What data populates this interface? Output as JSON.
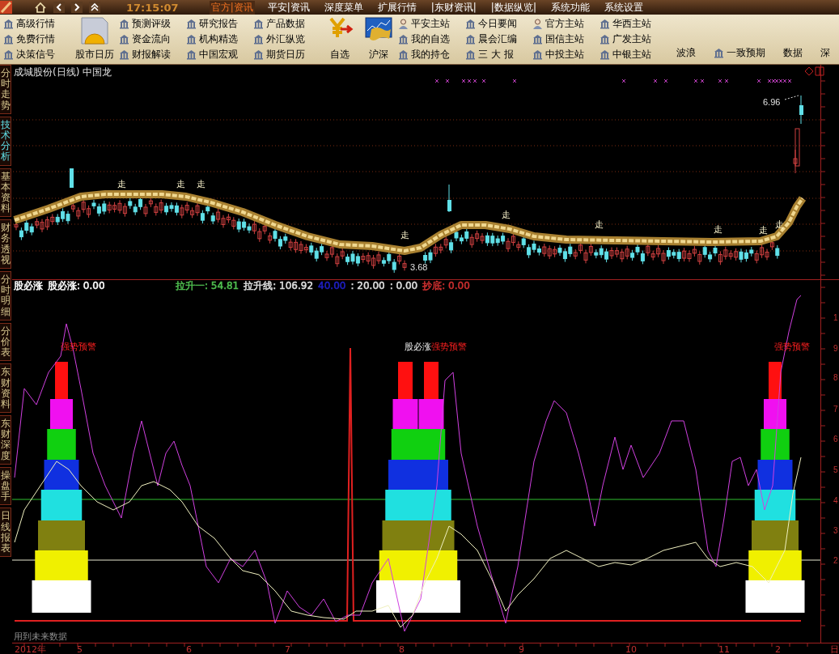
{
  "top_bar": {
    "time": "17:15:07",
    "menus": [
      {
        "label": "官方|资讯",
        "selected": true
      },
      {
        "label": "平安|资讯",
        "selected": false
      },
      {
        "label": "深度菜单",
        "selected": false
      },
      {
        "label": "扩展行情",
        "selected": false
      },
      {
        "label": "|东财资讯|",
        "selected": false
      },
      {
        "label": "|数据纵览|",
        "selected": false
      },
      {
        "label": "系统功能",
        "selected": false
      },
      {
        "label": "系统设置",
        "selected": false
      }
    ]
  },
  "toolbar": {
    "columns": [
      {
        "kind": "list",
        "items": [
          {
            "label": "高级行情",
            "kind": "bank"
          },
          {
            "label": "免费行情",
            "kind": "bank"
          },
          {
            "label": "决策信号",
            "kind": "bank"
          }
        ]
      },
      {
        "kind": "big",
        "label": "股市日历"
      },
      {
        "kind": "list",
        "items": [
          {
            "label": "预测评级",
            "kind": "bank"
          },
          {
            "label": "资金流向",
            "kind": "bank"
          },
          {
            "label": "财报解读",
            "kind": "bank"
          }
        ]
      },
      {
        "kind": "list",
        "items": [
          {
            "label": "研究报告",
            "kind": "bank"
          },
          {
            "label": "机构精选",
            "kind": "bank"
          },
          {
            "label": "中国宏观",
            "kind": "bank"
          }
        ]
      },
      {
        "kind": "list",
        "items": [
          {
            "label": "产品数据",
            "kind": "bank"
          },
          {
            "label": "外汇纵览",
            "kind": "bank"
          },
          {
            "label": "期货日历",
            "kind": "bank"
          }
        ]
      },
      {
        "kind": "big",
        "label": "自选"
      },
      {
        "kind": "big",
        "label": "沪深"
      },
      {
        "kind": "list",
        "items": [
          {
            "label": "平安主站",
            "kind": "person"
          },
          {
            "label": "我的自选",
            "kind": "bank"
          },
          {
            "label": "我的持仓",
            "kind": "bank"
          }
        ]
      },
      {
        "kind": "list",
        "items": [
          {
            "label": "今日要闻",
            "kind": "bank"
          },
          {
            "label": "晨会汇编",
            "kind": "bank"
          },
          {
            "label": "三 大 报",
            "kind": "bank"
          }
        ]
      },
      {
        "kind": "list",
        "items": [
          {
            "label": "官方主站",
            "kind": "person"
          },
          {
            "label": "国信主站",
            "kind": "bank"
          },
          {
            "label": "中投主站",
            "kind": "bank"
          }
        ]
      },
      {
        "kind": "list",
        "items": [
          {
            "label": "华西主站",
            "kind": "bank"
          },
          {
            "label": "广发主站",
            "kind": "bank"
          },
          {
            "label": "中银主站",
            "kind": "bank"
          }
        ]
      },
      {
        "kind": "row",
        "items": [
          {
            "label": "波浪",
            "kind": "plain"
          },
          {
            "label": "一致预期",
            "kind": "bank"
          },
          {
            "label": "数据",
            "kind": "plain"
          },
          {
            "label": "深",
            "kind": "plain"
          }
        ]
      }
    ]
  },
  "side_tabs": [
    {
      "label": "分时走势",
      "selected": false
    },
    {
      "label": "技术分析",
      "selected": true
    },
    {
      "label": "基本资料",
      "selected": false
    },
    {
      "label": "财务透视",
      "selected": false
    },
    {
      "label": "分时明细",
      "selected": false
    },
    {
      "label": "分价表",
      "selected": false
    },
    {
      "label": "东财资料",
      "selected": false
    },
    {
      "label": "东财深度",
      "selected": false
    },
    {
      "label": "操盘手",
      "selected": false
    },
    {
      "label": "日线报表",
      "selected": false
    }
  ],
  "price_panel": {
    "title": "成城股份(日线) 中国龙",
    "high_label": "6.96",
    "low_label": "3.68",
    "band_labels": [
      "走",
      "走",
      "走",
      "走",
      "走",
      "走",
      "走",
      "走",
      "走"
    ]
  },
  "indicator_panel": {
    "legend": [
      {
        "text": "股必涨",
        "color": "#ffffff"
      },
      {
        "text": "股必涨: 0.00",
        "color": "#ffffff"
      },
      {
        "text": "拉升一: 54.81",
        "color": "#50c050"
      },
      {
        "text": "拉升线: 106.92",
        "color": "#e0e0e0"
      },
      {
        "text": "40.00",
        "color": "#2020c8"
      },
      {
        "text": ": 20.00",
        "color": "#e0e0e0"
      },
      {
        "text": ": 0.00",
        "color": "#e0e0e0"
      },
      {
        "text": "抄底: 0.00",
        "color": "#d03030"
      }
    ],
    "signal_labels": [
      {
        "text": "强势预警",
        "kind": "warning"
      },
      {
        "text": "股必涨",
        "kind": "rise"
      },
      {
        "text": "强势预警",
        "kind": "warning"
      },
      {
        "text": "强势预警",
        "kind": "warning"
      }
    ],
    "axis_labels": [
      "1",
      "9",
      "8",
      "7",
      "6",
      "5",
      "4",
      "3",
      "2"
    ],
    "note": "用到未来数据"
  },
  "time_axis": {
    "labels": [
      "2012年",
      "5",
      "6",
      "7",
      "8",
      "9",
      "10",
      "11",
      "2"
    ],
    "unit": "日"
  }
}
